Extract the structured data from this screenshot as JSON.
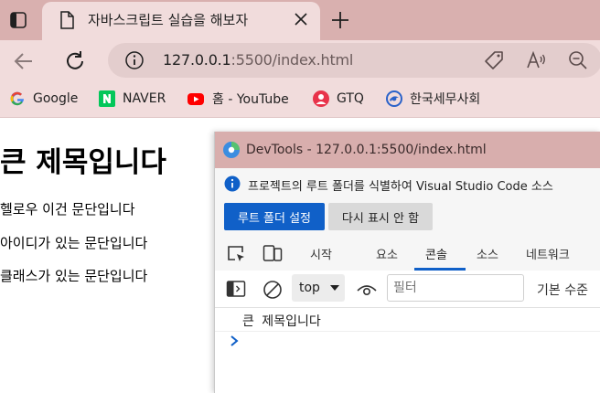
{
  "browser": {
    "tab": {
      "title": "자바스크립트 실습을 해보자"
    },
    "address": {
      "host": "127.0.0.1",
      "rest": ":5500/index.html"
    },
    "bookmarks": [
      {
        "label": "Google",
        "icon": "google-icon"
      },
      {
        "label": "NAVER",
        "icon": "naver-icon"
      },
      {
        "label": "홈 - YouTube",
        "icon": "youtube-icon"
      },
      {
        "label": "GTQ",
        "icon": "gtq-icon"
      },
      {
        "label": "한국세무사회",
        "icon": "tax-association-icon"
      }
    ],
    "colors": {
      "tabstrip": "#d9b0af",
      "toolbar": "#f1dcdc",
      "accent": "#1060c8"
    }
  },
  "page": {
    "heading": "큰 제목입니다",
    "paragraphs": [
      "헬로우 이건 문단입니다",
      "아이디가 있는 문단입니다",
      "클래스가 있는 문단입니다"
    ]
  },
  "devtools": {
    "title": "DevTools - 127.0.0.1:5500/index.html",
    "banner": {
      "text": "프로젝트의 루트 폴더를 식별하여 Visual Studio Code 소스",
      "primary_button": "루트 폴더 설정",
      "secondary_button": "다시 표시 안 함"
    },
    "tabs": [
      "시작",
      "요소",
      "콘솔",
      "소스",
      "네트워크"
    ],
    "active_tab": "콘솔",
    "console": {
      "context": "top",
      "filter_placeholder": "필터",
      "levels": "기본 수준",
      "messages": [
        "큰 제목입니다"
      ]
    }
  }
}
